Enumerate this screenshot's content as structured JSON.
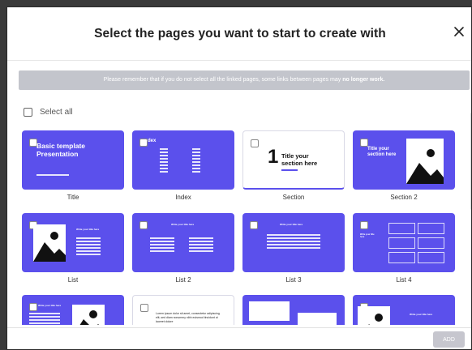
{
  "dialog": {
    "title": "Select the pages you want to start to create with",
    "close_symbol": "×",
    "notice_start": "Please remember that if you do not select all the linked pages, some links between pages may",
    "notice_bold": "no longer work.",
    "select_all_label": "Select all",
    "add_label": "ADD"
  },
  "pages": [
    {
      "label": "Title",
      "thumb_title": "Basic template Presentation"
    },
    {
      "label": "Index",
      "thumb_title": "dex"
    },
    {
      "label": "Section",
      "thumb_number": "1",
      "thumb_title": "Title your section here"
    },
    {
      "label": "Section 2",
      "thumb_title": "Title your section here"
    },
    {
      "label": "List",
      "thumb_title": "Write your title here"
    },
    {
      "label": "List 2",
      "thumb_title": "Write your title here"
    },
    {
      "label": "List 3",
      "thumb_title": "Write your title here"
    },
    {
      "label": "List 4",
      "thumb_title": "Write your title here"
    },
    {
      "label": "",
      "thumb_title": "Write your title here"
    },
    {
      "label": "",
      "thumb_title": "Lorem ipsum dolor sit amet, consectetur adipiscing elit, sed diam nonummy nibh euismod tincidunt ut laoreet dolore"
    },
    {
      "label": "",
      "thumb_title": ""
    },
    {
      "label": "",
      "thumb_title": "Write your title here"
    }
  ],
  "colors": {
    "brand": "#5b50ec",
    "banner": "#c3c5cc",
    "disabled_button": "#c6c6ce"
  }
}
